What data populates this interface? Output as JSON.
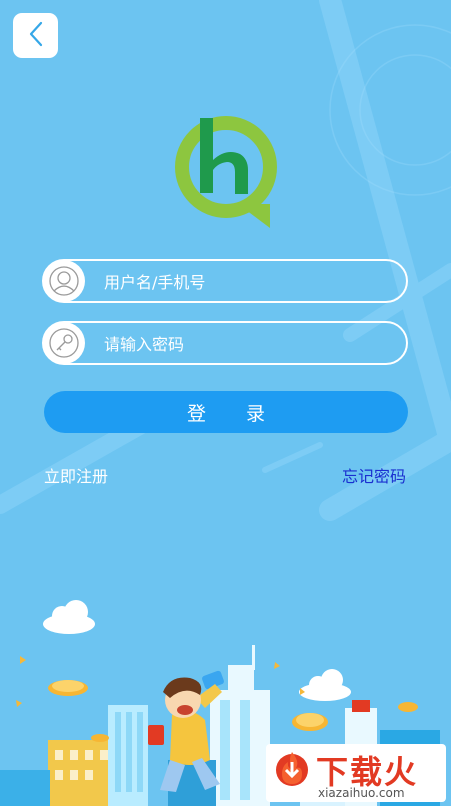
{
  "header": {
    "back_icon": "chevron-left-icon"
  },
  "logo": {
    "icon": "hq-logo-icon",
    "colors": {
      "green_light": "#8dc63f",
      "green_dark": "#1f9a4c"
    }
  },
  "login_form": {
    "username": {
      "placeholder": "用户名/手机号",
      "value": "",
      "icon": "user-avatar-icon"
    },
    "password": {
      "placeholder": "请输入密码",
      "value": "",
      "icon": "key-icon"
    },
    "login_label": "登录",
    "register_label": "立即注册",
    "forgot_label": "忘记密码"
  },
  "watermark": {
    "brand": "下载火",
    "site": "xiazaihuo.com",
    "icon": "download-flame-icon"
  },
  "colors": {
    "background": "#6cc4f1",
    "button": "#1e9cf2",
    "link_forgot": "#1a2fd0"
  }
}
